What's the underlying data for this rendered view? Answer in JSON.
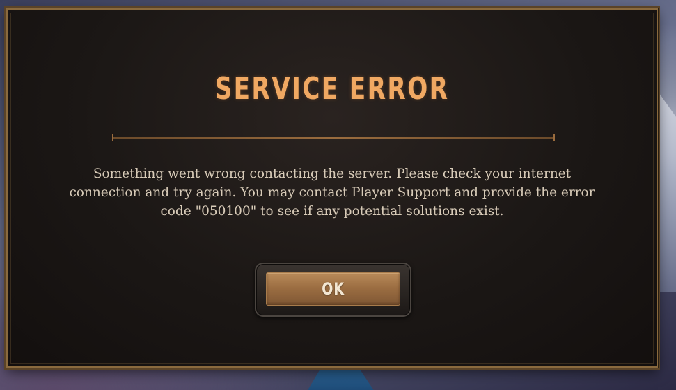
{
  "dialog": {
    "title": "SERVICE ERROR",
    "message": "Something went wrong contacting the server. Please check your internet connection and try again. You may contact Player Support and provide the error code \"050100\" to see if any potential solutions exist.",
    "ok_label": "OK"
  },
  "colors": {
    "title": "#f0a862",
    "message": "#d8cbb8",
    "button": "#9c6e42",
    "frame_border": "#8a6a3e"
  }
}
